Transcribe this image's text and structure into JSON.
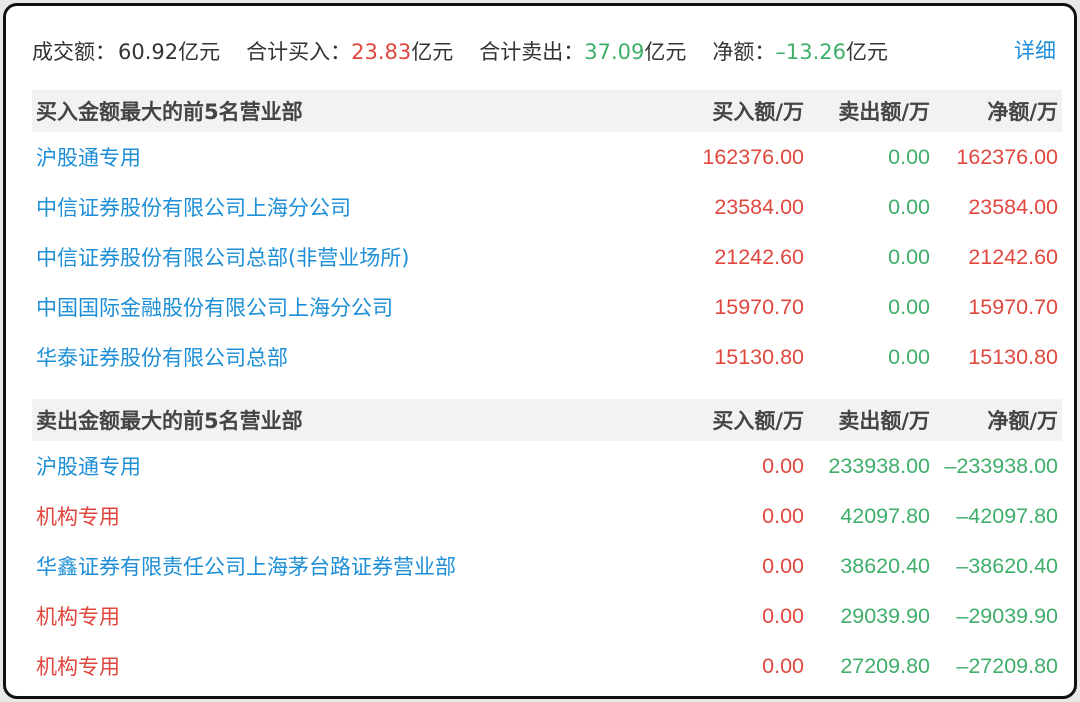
{
  "summary": {
    "turnover_label": "成交额：",
    "turnover_value": "60.92亿元",
    "buy_label": "合计买入：",
    "buy_value": "23.83",
    "buy_unit": "亿元",
    "sell_label": "合计卖出：",
    "sell_value": "37.09",
    "sell_unit": "亿元",
    "net_label": "净额：",
    "net_value": "–13.26",
    "net_unit": "亿元",
    "detail_link": "详细"
  },
  "buy_section": {
    "title": "买入金额最大的前5名营业部",
    "col_buy": "买入额/万",
    "col_sell": "卖出额/万",
    "col_net": "净额/万",
    "rows": [
      {
        "name": "沪股通专用",
        "buy": "162376.00",
        "sell": "0.00",
        "net": "162376.00"
      },
      {
        "name": "中信证券股份有限公司上海分公司",
        "buy": "23584.00",
        "sell": "0.00",
        "net": "23584.00"
      },
      {
        "name": "中信证券股份有限公司总部(非营业场所)",
        "buy": "21242.60",
        "sell": "0.00",
        "net": "21242.60"
      },
      {
        "name": "中国国际金融股份有限公司上海分公司",
        "buy": "15970.70",
        "sell": "0.00",
        "net": "15970.70"
      },
      {
        "name": "华泰证券股份有限公司总部",
        "buy": "15130.80",
        "sell": "0.00",
        "net": "15130.80"
      }
    ]
  },
  "sell_section": {
    "title": "卖出金额最大的前5名营业部",
    "col_buy": "买入额/万",
    "col_sell": "卖出额/万",
    "col_net": "净额/万",
    "rows": [
      {
        "name": "沪股通专用",
        "buy": "0.00",
        "sell": "233938.00",
        "net": "–233938.00"
      },
      {
        "name": "机构专用",
        "buy": "0.00",
        "sell": "42097.80",
        "net": "–42097.80"
      },
      {
        "name": "华鑫证券有限责任公司上海茅台路证券营业部",
        "buy": "0.00",
        "sell": "38620.40",
        "net": "–38620.40"
      },
      {
        "name": "机构专用",
        "buy": "0.00",
        "sell": "29039.90",
        "net": "–29039.90"
      },
      {
        "name": "机构专用",
        "buy": "0.00",
        "sell": "27209.80",
        "net": "–27209.80"
      }
    ]
  },
  "colors": {
    "up": "#e0473e",
    "down": "#3fae6a",
    "link": "#1e8fd6",
    "institution": "#e0473e"
  }
}
